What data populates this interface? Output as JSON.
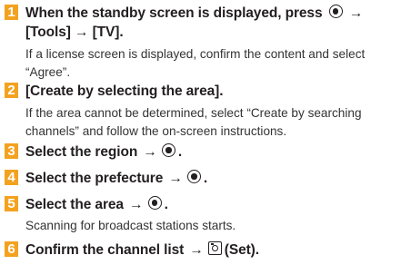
{
  "accent_color": "#f3a21f",
  "steps": [
    {
      "num": "1",
      "title_a": "When the standby screen is displayed, press",
      "title_b": "→",
      "title_line2": "[Tools] → [TV].",
      "desc_line1": "If a license screen is displayed, confirm the content and select",
      "desc_line2": "“Agree”.",
      "icon": "center-button-icon"
    },
    {
      "num": "2",
      "title": "[Create by selecting the area].",
      "desc_line1": "If the area cannot be determined, select “Create by searching",
      "desc_line2": "channels” and follow the on-screen instructions."
    },
    {
      "num": "3",
      "title_a": "Select the region",
      "arrow": "→",
      "title_end": ".",
      "icon": "center-button-icon"
    },
    {
      "num": "4",
      "title_a": "Select the prefecture",
      "arrow": "→",
      "title_end": ".",
      "icon": "center-button-icon"
    },
    {
      "num": "5",
      "title_a": "Select the area",
      "arrow": "→",
      "title_end": ".",
      "desc_line1": "Scanning for broadcast stations starts.",
      "icon": "center-button-icon"
    },
    {
      "num": "6",
      "title_a": "Confirm the channel list",
      "arrow": "→",
      "title_end": "(Set).",
      "icon": "camera-button-icon"
    }
  ]
}
